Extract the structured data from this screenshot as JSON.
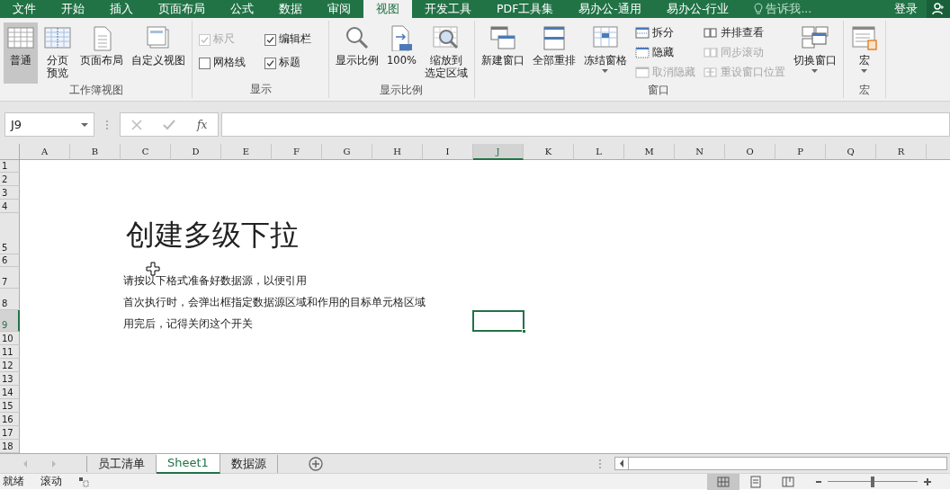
{
  "menu_tabs": [
    {
      "label": "文件",
      "selected": false
    },
    {
      "label": "开始",
      "selected": false
    },
    {
      "label": "插入",
      "selected": false
    },
    {
      "label": "页面布局",
      "selected": false
    },
    {
      "label": "公式",
      "selected": false
    },
    {
      "label": "数据",
      "selected": false
    },
    {
      "label": "审阅",
      "selected": false
    },
    {
      "label": "视图",
      "selected": true
    },
    {
      "label": "开发工具",
      "selected": false
    },
    {
      "label": "PDF工具集",
      "selected": false
    },
    {
      "label": "易办公-通用",
      "selected": false
    },
    {
      "label": "易办公-行业",
      "selected": false
    }
  ],
  "tell_me": {
    "placeholder": "告诉我..."
  },
  "sign_in": "登录",
  "ribbon_groups": [
    {
      "label": "工作簿视图",
      "items": [
        {
          "kind": "large",
          "label": "普通",
          "selected": true
        },
        {
          "kind": "large",
          "lines": [
            "分页",
            "预览"
          ],
          "selected": false
        },
        {
          "kind": "large",
          "label": "页面布局",
          "selected": false
        },
        {
          "kind": "large",
          "label": "自定义视图",
          "selected": false
        }
      ]
    },
    {
      "label": "显示",
      "items": [
        {
          "kind": "check",
          "label": "标尺",
          "checked": true,
          "disabled": true
        },
        {
          "kind": "check",
          "label": "网格线",
          "checked": false,
          "disabled": false
        },
        {
          "kind": "check",
          "label": "编辑栏",
          "checked": true,
          "disabled": false
        },
        {
          "kind": "check",
          "label": "标题",
          "checked": true,
          "disabled": false
        }
      ]
    },
    {
      "label": "显示比例",
      "items": [
        {
          "kind": "large",
          "label": "显示比例",
          "selected": false
        },
        {
          "kind": "large",
          "label": "100%",
          "selected": false
        },
        {
          "kind": "large",
          "lines": [
            "缩放到",
            "选定区域"
          ],
          "selected": false
        }
      ]
    },
    {
      "label": "窗口",
      "items": [
        {
          "kind": "large",
          "label": "新建窗口",
          "selected": false
        },
        {
          "kind": "large",
          "label": "全部重排",
          "selected": false
        },
        {
          "kind": "large",
          "label": "冻结窗格",
          "selected": false,
          "dropdown": true
        },
        {
          "kind": "small",
          "label": "拆分",
          "disabled": false
        },
        {
          "kind": "small",
          "label": "隐藏",
          "disabled": false
        },
        {
          "kind": "small",
          "label": "取消隐藏",
          "disabled": true
        },
        {
          "kind": "small",
          "label": "并排查看",
          "disabled": false
        },
        {
          "kind": "small",
          "label": "同步滚动",
          "disabled": true
        },
        {
          "kind": "small",
          "label": "重设窗口位置",
          "disabled": true
        },
        {
          "kind": "large",
          "label": "切换窗口",
          "selected": false,
          "dropdown": true
        }
      ]
    },
    {
      "label": "宏",
      "items": [
        {
          "kind": "large",
          "label": "宏",
          "selected": false,
          "dropdown": true
        }
      ]
    }
  ],
  "formula_bar": {
    "name_box": "J9",
    "function_label": "fx"
  },
  "columns": [
    {
      "label": "A",
      "selected": false
    },
    {
      "label": "B",
      "selected": false
    },
    {
      "label": "C",
      "selected": false
    },
    {
      "label": "D",
      "selected": false
    },
    {
      "label": "E",
      "selected": false
    },
    {
      "label": "F",
      "selected": false
    },
    {
      "label": "G",
      "selected": false
    },
    {
      "label": "H",
      "selected": false
    },
    {
      "label": "I",
      "selected": false
    },
    {
      "label": "J",
      "selected": true
    },
    {
      "label": "K",
      "selected": false
    },
    {
      "label": "L",
      "selected": false
    },
    {
      "label": "M",
      "selected": false
    },
    {
      "label": "N",
      "selected": false
    },
    {
      "label": "O",
      "selected": false
    },
    {
      "label": "P",
      "selected": false
    },
    {
      "label": "Q",
      "selected": false
    },
    {
      "label": "R",
      "selected": false
    }
  ],
  "rows": [
    {
      "label": "1",
      "selected": false
    },
    {
      "label": "2",
      "selected": false
    },
    {
      "label": "3",
      "selected": false
    },
    {
      "label": "4",
      "selected": false
    },
    {
      "label": "5",
      "selected": false,
      "kind": "title",
      "text": "创建多级下拉"
    },
    {
      "label": "6",
      "selected": false
    },
    {
      "label": "7",
      "selected": false,
      "kind": "text",
      "text": "请按以下格式准备好数据源，以便引用"
    },
    {
      "label": "8",
      "selected": false,
      "kind": "text",
      "text": "首次执行时，会弹出框指定数据源区域和作用的目标单元格区域"
    },
    {
      "label": "9",
      "selected": true,
      "kind": "text",
      "text": "用完后，记得关闭这个开关"
    },
    {
      "label": "10",
      "selected": false
    },
    {
      "label": "11",
      "selected": false
    },
    {
      "label": "12",
      "selected": false
    },
    {
      "label": "13",
      "selected": false
    },
    {
      "label": "14",
      "selected": false
    },
    {
      "label": "15",
      "selected": false
    },
    {
      "label": "16",
      "selected": false
    },
    {
      "label": "17",
      "selected": false
    },
    {
      "label": "18",
      "selected": false
    }
  ],
  "sheet_tabs": [
    {
      "label": "员工清单",
      "selected": false
    },
    {
      "label": "Sheet1",
      "selected": true
    },
    {
      "label": "数据源",
      "selected": false
    }
  ],
  "status_bar": {
    "ready": "就绪",
    "scroll": "滚动"
  },
  "view_buttons": [
    {
      "selected": true
    },
    {
      "selected": false
    },
    {
      "selected": false
    }
  ],
  "zoom": {
    "level": 0.5
  }
}
